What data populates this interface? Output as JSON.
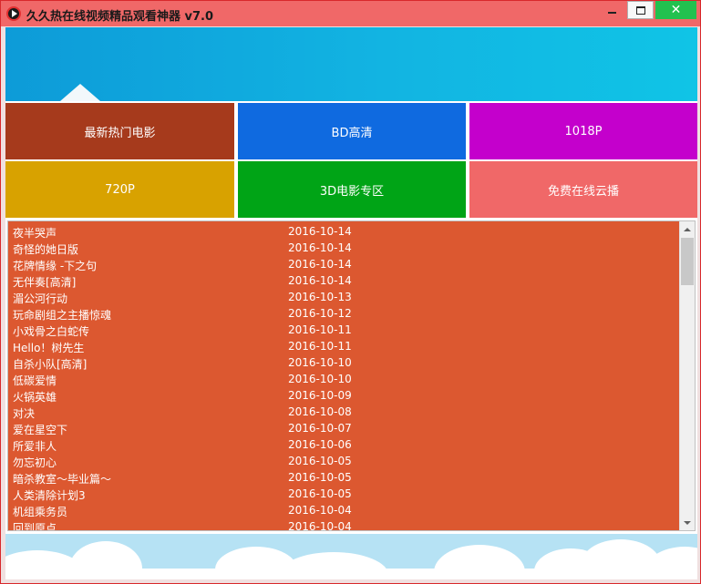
{
  "window": {
    "title": "久久热在线视频精品观看神器 v7.0",
    "close_glyph": "✕"
  },
  "tiles": [
    {
      "label": "最新热门电影",
      "color": "#a63a1c"
    },
    {
      "label": "BD高清",
      "color": "#0f6ae0"
    },
    {
      "label": "1018P",
      "color": "#c400cc"
    },
    {
      "label": "720P",
      "color": "#d8a200"
    },
    {
      "label": "3D电影专区",
      "color": "#00a416"
    },
    {
      "label": "免费在线云播",
      "color": "#f06868"
    }
  ],
  "movies": [
    {
      "title": "夜半哭声",
      "date": "2016-10-14"
    },
    {
      "title": "奇怪的她日版",
      "date": "2016-10-14"
    },
    {
      "title": "花牌情缘 -下之句",
      "date": "2016-10-14"
    },
    {
      "title": "无伴奏[高清]",
      "date": "2016-10-14"
    },
    {
      "title": "湄公河行动",
      "date": "2016-10-13"
    },
    {
      "title": "玩命剧组之主播惊魂",
      "date": "2016-10-12"
    },
    {
      "title": "小戏骨之白蛇传",
      "date": "2016-10-11"
    },
    {
      "title": "Hello！树先生",
      "date": "2016-10-11"
    },
    {
      "title": "自杀小队[高清]",
      "date": "2016-10-10"
    },
    {
      "title": "低碳爱情",
      "date": "2016-10-10"
    },
    {
      "title": "火锅英雄",
      "date": "2016-10-09"
    },
    {
      "title": "对决",
      "date": "2016-10-08"
    },
    {
      "title": "爱在星空下",
      "date": "2016-10-07"
    },
    {
      "title": "所爱非人",
      "date": "2016-10-06"
    },
    {
      "title": "勿忘初心",
      "date": "2016-10-05"
    },
    {
      "title": "暗杀教室～毕业篇～",
      "date": "2016-10-05"
    },
    {
      "title": "人类清除计划3",
      "date": "2016-10-05"
    },
    {
      "title": "机组乘务员",
      "date": "2016-10-04"
    },
    {
      "title": "回到原点",
      "date": "2016-10-04"
    }
  ],
  "colors": {
    "title_bar": "#f06868",
    "list_background": "#dc5830",
    "banner": "#12b4e2"
  },
  "icons": {
    "app": "play-icon",
    "minimize": "minimize-icon",
    "maximize": "maximize-icon",
    "close": "close-icon"
  }
}
